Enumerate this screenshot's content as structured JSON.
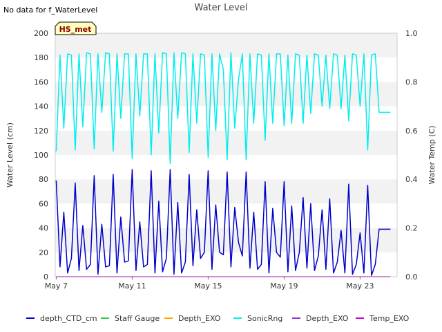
{
  "chart_data": {
    "type": "line",
    "title": "Water Level",
    "note": "No data for f_WaterLevel",
    "badge": "HS_met",
    "ylabel": "Water Level (cm)",
    "y2label": "Water Temp (C)",
    "ylim": [
      0,
      200
    ],
    "y2lim": [
      0,
      1
    ],
    "yticks": [
      0,
      20,
      40,
      60,
      80,
      100,
      120,
      140,
      160,
      180,
      200
    ],
    "y2ticks": [
      "0.0",
      "0.2",
      "0.4",
      "0.6",
      "0.8",
      "1.0"
    ],
    "xlim": [
      "2024-05-07",
      "2024-05-25"
    ],
    "xticks": [
      "May 7",
      "May 11",
      "May 15",
      "May 19",
      "May 23"
    ],
    "grid": "horizontal bands",
    "series": [
      {
        "name": "depth_CTD_cm",
        "color": "#0000cc",
        "x": [
          7.0,
          7.2,
          7.4,
          7.6,
          7.8,
          8.0,
          8.2,
          8.4,
          8.6,
          8.8,
          9.0,
          9.2,
          9.4,
          9.6,
          9.8,
          10.0,
          10.2,
          10.4,
          10.6,
          10.8,
          11.0,
          11.2,
          11.4,
          11.6,
          11.8,
          12.0,
          12.2,
          12.4,
          12.6,
          12.8,
          13.0,
          13.2,
          13.4,
          13.6,
          13.8,
          14.0,
          14.2,
          14.4,
          14.6,
          14.8,
          15.0,
          15.2,
          15.4,
          15.6,
          15.8,
          16.0,
          16.2,
          16.4,
          16.6,
          16.8,
          17.0,
          17.2,
          17.4,
          17.6,
          17.8,
          18.0,
          18.2,
          18.4,
          18.6,
          18.8,
          19.0,
          19.2,
          19.4,
          19.6,
          19.8,
          20.0,
          20.2,
          20.4,
          20.6,
          20.8,
          21.0,
          21.2,
          21.4,
          21.6,
          21.8,
          22.0,
          22.2,
          22.4,
          22.6,
          22.8,
          23.0,
          23.2,
          23.4,
          23.6,
          23.8,
          24.0,
          24.2,
          24.4,
          24.6
        ],
        "values": [
          79,
          8,
          53,
          3,
          15,
          77,
          5,
          42,
          6,
          10,
          83,
          2,
          43,
          8,
          9,
          84,
          3,
          49,
          12,
          13,
          88,
          5,
          45,
          8,
          10,
          87,
          3,
          62,
          4,
          15,
          88,
          2,
          61,
          3,
          12,
          84,
          9,
          55,
          15,
          20,
          87,
          6,
          59,
          20,
          18,
          86,
          8,
          57,
          28,
          17,
          86,
          7,
          53,
          6,
          10,
          78,
          3,
          56,
          20,
          16,
          78,
          4,
          58,
          5,
          20,
          65,
          7,
          60,
          5,
          17,
          55,
          6,
          64,
          3,
          12,
          38,
          3,
          76,
          2,
          10,
          36,
          3,
          75,
          1,
          10,
          39,
          39,
          39,
          39
        ]
      },
      {
        "name": "Staff Gauge",
        "color": "#33cc33",
        "x": [],
        "values": []
      },
      {
        "name": "Depth_EXO",
        "color": "#ffa500",
        "x": [],
        "values": []
      },
      {
        "name": "SonicRng",
        "color": "#00eeee",
        "x": [
          7.0,
          7.2,
          7.4,
          7.6,
          7.8,
          8.0,
          8.2,
          8.4,
          8.6,
          8.8,
          9.0,
          9.2,
          9.4,
          9.6,
          9.8,
          10.0,
          10.2,
          10.4,
          10.6,
          10.8,
          11.0,
          11.2,
          11.4,
          11.6,
          11.8,
          12.0,
          12.2,
          12.4,
          12.6,
          12.8,
          13.0,
          13.2,
          13.4,
          13.6,
          13.8,
          14.0,
          14.2,
          14.4,
          14.6,
          14.8,
          15.0,
          15.2,
          15.4,
          15.6,
          15.8,
          16.0,
          16.2,
          16.4,
          16.6,
          16.8,
          17.0,
          17.2,
          17.4,
          17.6,
          17.8,
          18.0,
          18.2,
          18.4,
          18.6,
          18.8,
          19.0,
          19.2,
          19.4,
          19.6,
          19.8,
          20.0,
          20.2,
          20.4,
          20.6,
          20.8,
          21.0,
          21.2,
          21.4,
          21.6,
          21.8,
          22.0,
          22.2,
          22.4,
          22.6,
          22.8,
          23.0,
          23.2,
          23.4,
          23.6,
          23.8,
          24.0,
          24.2,
          24.4,
          24.6
        ],
        "values": [
          103,
          182,
          122,
          183,
          182,
          104,
          183,
          123,
          184,
          183,
          105,
          183,
          135,
          184,
          183,
          103,
          183,
          130,
          183,
          183,
          97,
          183,
          132,
          183,
          183,
          100,
          183,
          118,
          184,
          183,
          93,
          184,
          130,
          184,
          183,
          102,
          183,
          126,
          183,
          182,
          98,
          183,
          120,
          183,
          170,
          96,
          184,
          122,
          162,
          183,
          96,
          183,
          126,
          183,
          182,
          112,
          183,
          126,
          183,
          183,
          124,
          182,
          126,
          183,
          182,
          126,
          182,
          134,
          183,
          182,
          140,
          182,
          138,
          183,
          182,
          138,
          182,
          128,
          183,
          182,
          140,
          183,
          104,
          182,
          183,
          135,
          135,
          135,
          135
        ]
      },
      {
        "name": "Depth_EXO",
        "color": "#9933cc",
        "x": [
          7.0,
          24.6
        ],
        "values": [
          0,
          0
        ]
      },
      {
        "name": "Temp_EXO",
        "color": "#cc00cc",
        "x": [
          7.0,
          24.6
        ],
        "values": [
          0,
          0
        ]
      }
    ]
  }
}
